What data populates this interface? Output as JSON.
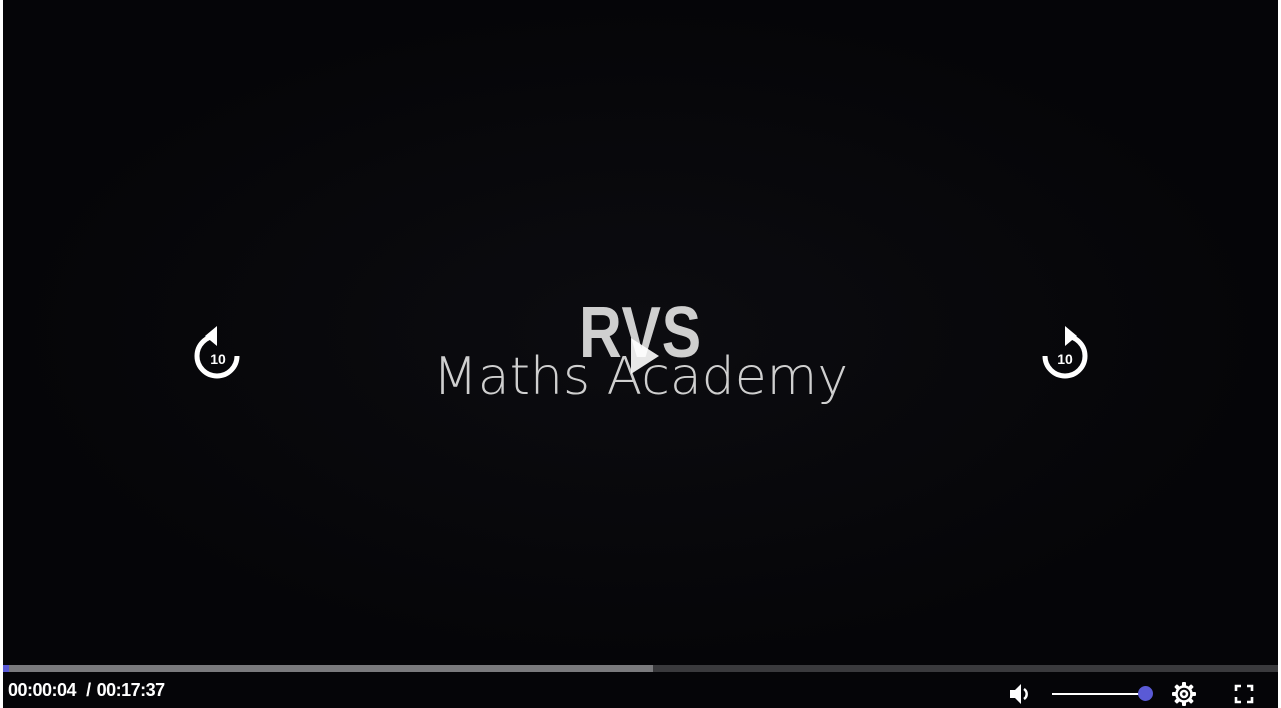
{
  "video": {
    "logo_title": "RVS",
    "logo_subtitle": "Maths Academy"
  },
  "controls": {
    "rewind": {
      "icon": "rewind-10-icon",
      "label": "10"
    },
    "forward": {
      "icon": "forward-10-icon",
      "label": "10"
    },
    "play_icon": "play-icon",
    "current_time": "00:00:04",
    "separator": "/",
    "duration": "00:17:37",
    "progress_played_fraction": 0.004,
    "progress_buffered_fraction": 0.51,
    "volume_icon": "volume-icon",
    "volume_level": 1.0,
    "settings_icon": "gear-icon",
    "fullscreen_icon": "fullscreen-icon"
  },
  "colors": {
    "accent": "#5a5ad6",
    "background": "#050508",
    "buffer": "#7a7a7d",
    "track": "#3a3a3d"
  }
}
